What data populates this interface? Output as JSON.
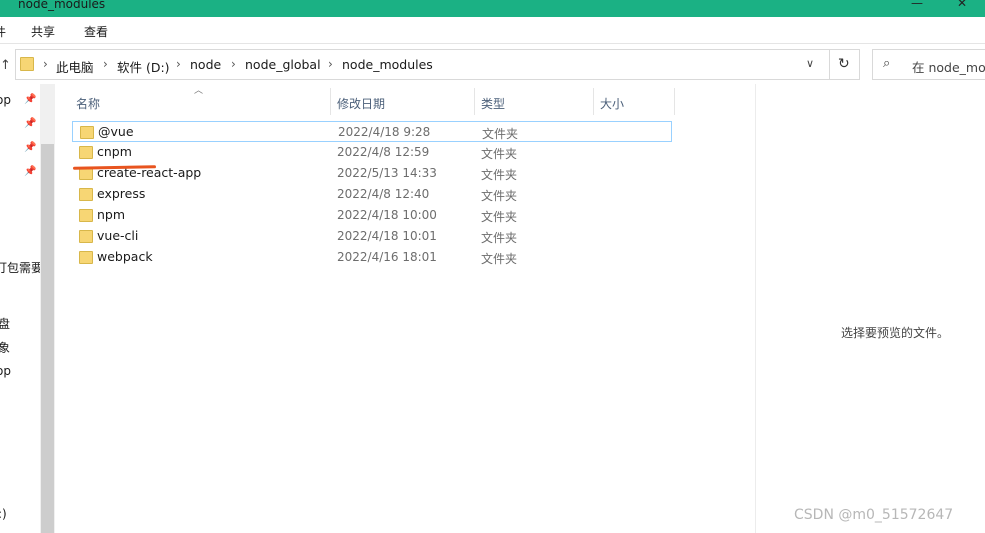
{
  "window": {
    "title": "node_modules",
    "controls": {
      "minimize": "—",
      "maximize": "☐",
      "close": "✕"
    }
  },
  "ribbon": {
    "tabs": [
      "件",
      "共享",
      "查看"
    ]
  },
  "address": {
    "crumbs": [
      "此电脑",
      "软件 (D:)",
      "node",
      "node_global",
      "node_modules"
    ],
    "separator": "›",
    "dropdown": "∨",
    "refresh": "↻",
    "search_icon": "search-icon",
    "search_placeholder": "在 node_modu"
  },
  "nav": {
    "items": [
      {
        "label": "op",
        "pinned": true
      },
      {
        "label": "",
        "pinned": true
      },
      {
        "label": "",
        "pinned": true
      },
      {
        "label": "",
        "pinned": true
      },
      {
        "label": "打包需要",
        "pinned": false
      },
      {
        "label": "盘",
        "pinned": false
      },
      {
        "label": "象",
        "pinned": false
      },
      {
        "label": "op",
        "pinned": false
      },
      {
        "label": ":)",
        "pinned": false
      }
    ],
    "pin_glyph": "📌"
  },
  "filelist": {
    "columns": [
      "名称",
      "修改日期",
      "类型",
      "大小"
    ],
    "sort_glyph": "︿",
    "rows": [
      {
        "name": "@vue",
        "date": "2022/4/18 9:28",
        "type": "文件夹",
        "selected": true
      },
      {
        "name": "cnpm",
        "date": "2022/4/8 12:59",
        "type": "文件夹",
        "selected": false
      },
      {
        "name": "create-react-app",
        "date": "2022/5/13 14:33",
        "type": "文件夹",
        "selected": false
      },
      {
        "name": "express",
        "date": "2022/4/8 12:40",
        "type": "文件夹",
        "selected": false
      },
      {
        "name": "npm",
        "date": "2022/4/18 10:00",
        "type": "文件夹",
        "selected": false
      },
      {
        "name": "vue-cli",
        "date": "2022/4/18 10:01",
        "type": "文件夹",
        "selected": false
      },
      {
        "name": "webpack",
        "date": "2022/4/16 18:01",
        "type": "文件夹",
        "selected": false
      }
    ]
  },
  "preview": {
    "text": "选择要预览的文件。"
  },
  "watermark": "CSDN @m0_51572647",
  "colors": {
    "titlebar": "#1bb184",
    "folder": "#f7d674",
    "selection_border": "#99d1ff",
    "annotation": "#e8541f"
  }
}
